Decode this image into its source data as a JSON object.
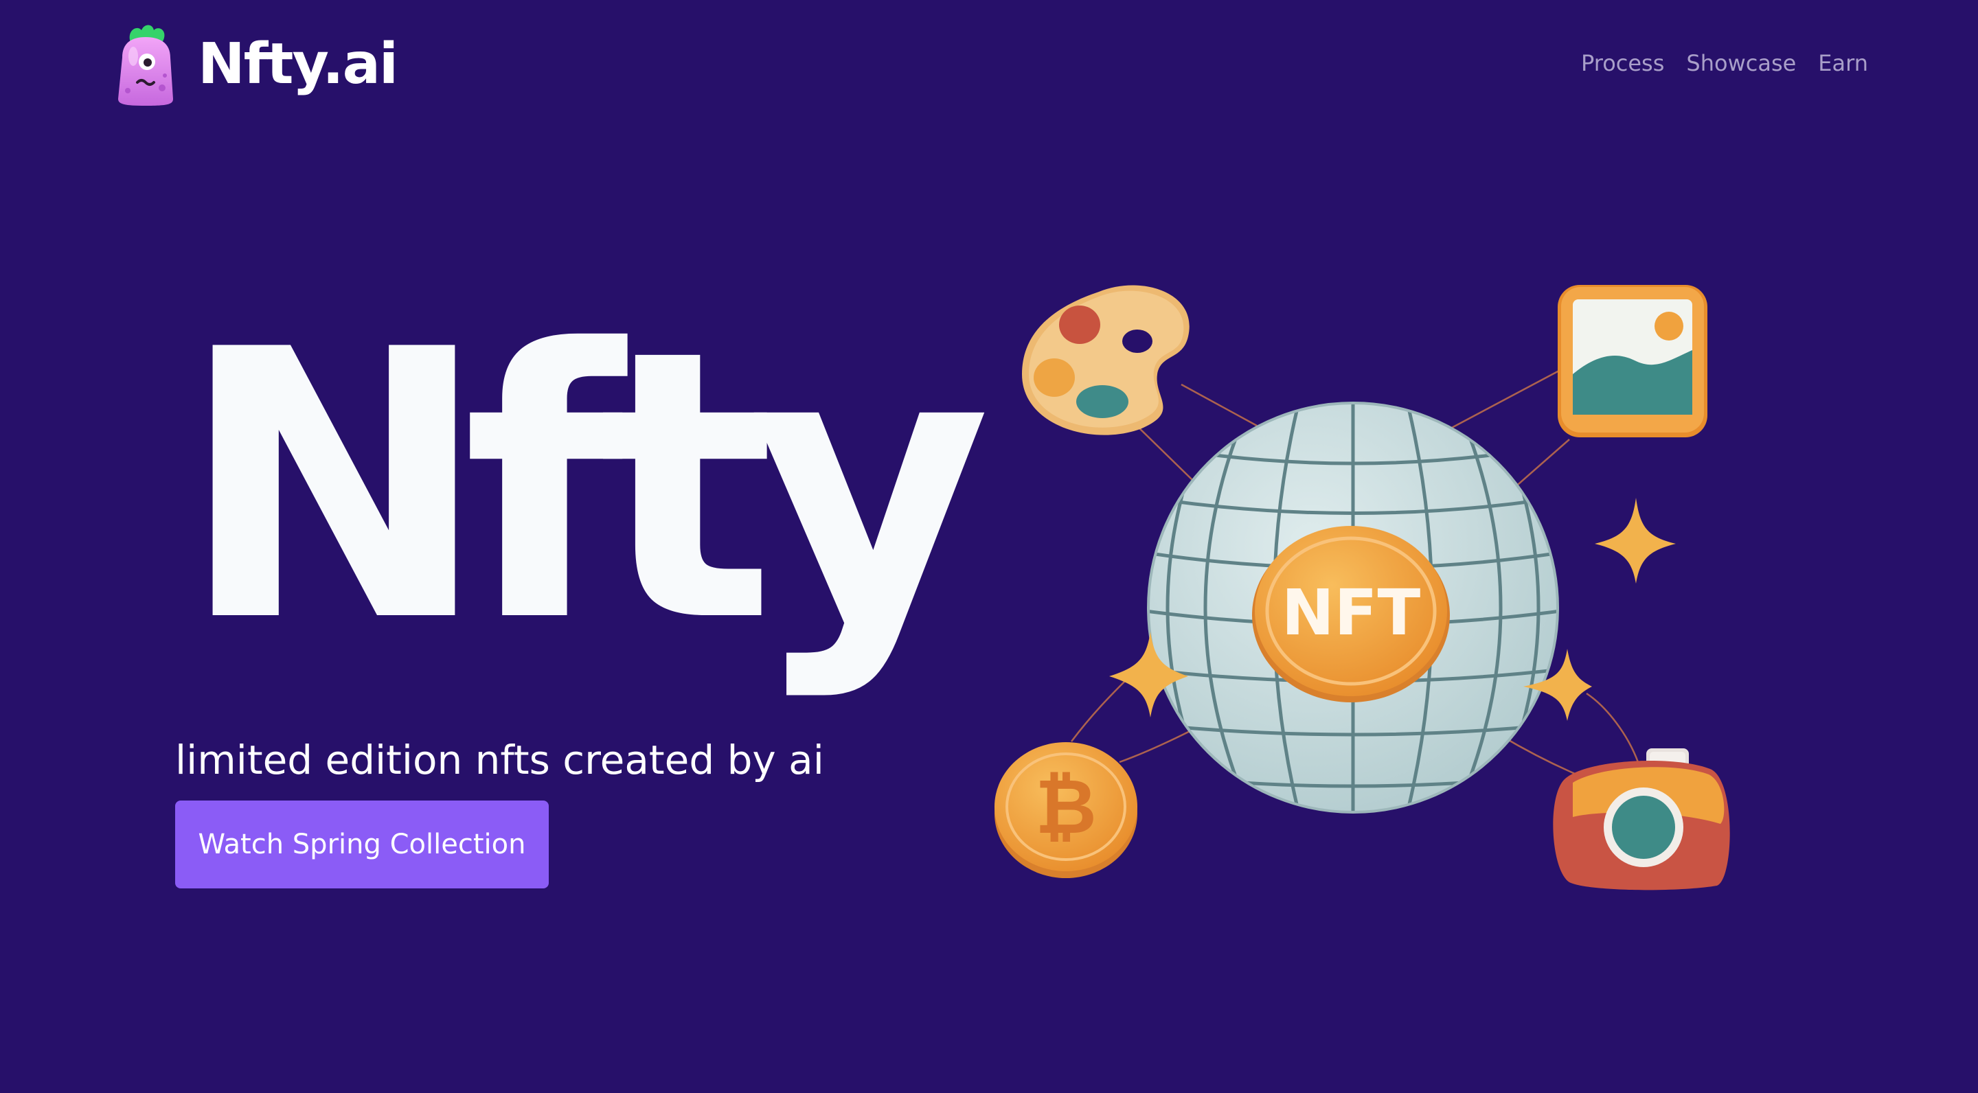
{
  "brand": {
    "name": "Nfty.ai",
    "mascot_icon": "purple-monster-mascot-icon"
  },
  "nav": {
    "items": [
      {
        "label": "Process"
      },
      {
        "label": "Showcase"
      },
      {
        "label": "Earn"
      }
    ]
  },
  "hero": {
    "title": "Nfty",
    "subtitle": "limited edition nfts created by ai",
    "cta_label": "Watch Spring Collection"
  },
  "illustration": {
    "center_label": "NFT",
    "icons": [
      "paint-palette-icon",
      "image-frame-icon",
      "bitcoin-coin-icon",
      "camera-icon",
      "globe-icon",
      "sparkle-star-icon"
    ]
  },
  "colors": {
    "background": "#27106a",
    "accent": "#8b5cf6",
    "nav_text": "#a99fc9",
    "headline": "#f8fafc",
    "orange": "#f0a23e",
    "globe": "#c9dbdd",
    "globe_lines": "#5f8287"
  }
}
